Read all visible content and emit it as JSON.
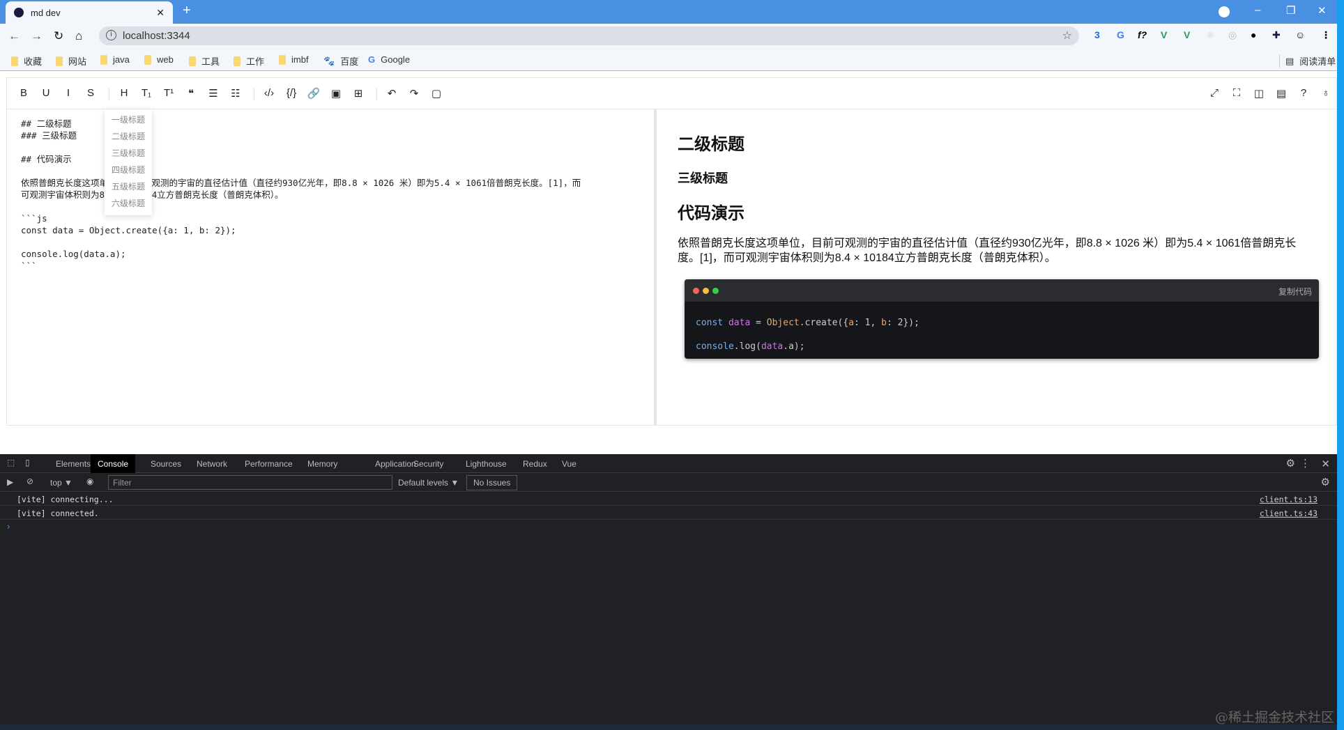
{
  "browser": {
    "tab_title": "md dev",
    "url": "localhost:3344",
    "bookmarks": [
      "收藏",
      "网站",
      "java",
      "web",
      "工具",
      "工作",
      "imbf",
      "百度",
      "Google"
    ],
    "reading_list": "阅读清单"
  },
  "toolbar": {
    "left": [
      "B",
      "U",
      "I",
      "S",
      "H",
      "T₁",
      "T¹",
      "❝",
      "☰",
      "☷",
      "‹/›",
      "{/}",
      "🔗",
      "▣",
      "⊞",
      "↶",
      "↷",
      "▢"
    ],
    "right": [
      "⤢",
      "⛶",
      "◫",
      "▤",
      "?",
      "♁"
    ]
  },
  "heading_menu": [
    "一级标题",
    "二级标题",
    "三级标题",
    "四级标题",
    "五级标题",
    "六级标题"
  ],
  "source": "## 二级标题\n### 三级标题\n\n## 代码演示\n\n依照普朗克长度这项单位，目前可观测的宇宙的直径估计值（直径约930亿光年，即8.8 × 1026 米）即为5.4 × 1061倍普朗克长度。[1]，而\n可观测宇宙体积则为8.4 × 10184立方普朗克长度（普朗克体积）。\n\n```js\nconst data = Object.create({a: 1, b: 2});\n\nconsole.log(data.a);\n```",
  "preview": {
    "h2": "二级标题",
    "h3": "三级标题",
    "h2b": "代码演示",
    "paragraph": "依照普朗克长度这项单位，目前可观测的宇宙的直径估计值（直径约930亿光年，即8.8 × 1026 米）即为5.4 × 1061倍普朗克长度。[1]，而可观测宇宙体积则为8.4 × 10184立方普朗克长度（普朗克体积）。",
    "copy_label": "复制代码"
  },
  "devtools": {
    "tabs": [
      "Elements",
      "Console",
      "Sources",
      "Network",
      "Performance",
      "Memory",
      "Application",
      "Security",
      "Lighthouse",
      "Redux",
      "Vue"
    ],
    "context": "top ▼",
    "filter_placeholder": "Filter",
    "levels": "Default levels ▼",
    "issues": "No Issues",
    "logs": [
      {
        "text": "[vite] connecting...",
        "source": "client.ts:13"
      },
      {
        "text": "[vite] connected.",
        "source": "client.ts:43"
      }
    ]
  },
  "watermark": "@稀土掘金技术社区"
}
